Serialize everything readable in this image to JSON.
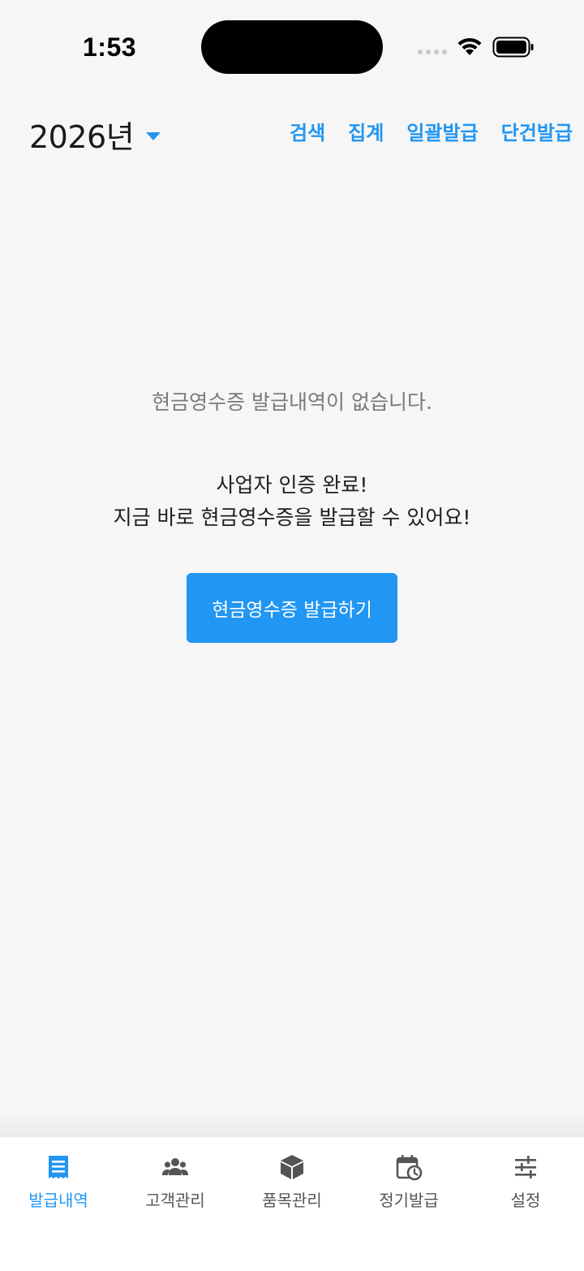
{
  "status_bar": {
    "time": "1:53"
  },
  "header": {
    "year_label": "2026년",
    "actions": [
      {
        "label": "검색"
      },
      {
        "label": "집계"
      },
      {
        "label": "일괄발급"
      },
      {
        "label": "단건발급"
      }
    ]
  },
  "empty_state": {
    "message": "현금영수증 발급내역이 없습니다.",
    "auth_line1": "사업자 인증 완료!",
    "auth_line2": "지금 바로 현금영수증을 발급할 수 있어요!",
    "button_label": "현금영수증 발급하기"
  },
  "bottom_nav": {
    "items": [
      {
        "label": "발급내역",
        "icon": "receipt-list-icon",
        "active": true
      },
      {
        "label": "고객관리",
        "icon": "people-group-icon",
        "active": false
      },
      {
        "label": "품목관리",
        "icon": "box-icon",
        "active": false
      },
      {
        "label": "정기발급",
        "icon": "calendar-clock-icon",
        "active": false
      },
      {
        "label": "설정",
        "icon": "sliders-icon",
        "active": false
      }
    ]
  },
  "colors": {
    "accent": "#2196f3",
    "background": "#f6f6f6",
    "inactive_icon": "#555555"
  }
}
